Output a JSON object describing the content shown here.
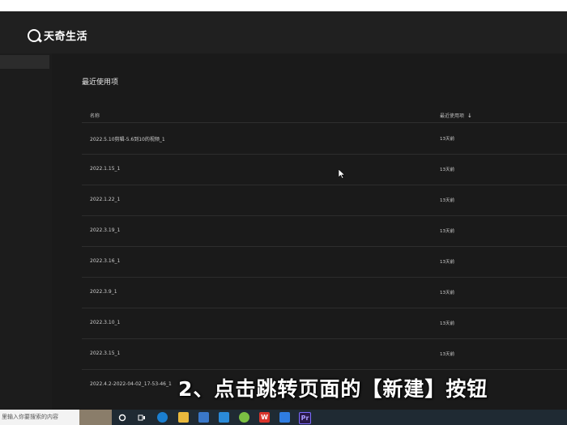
{
  "watermark": {
    "text": "天奇生活"
  },
  "section_title": "最近使用项",
  "table": {
    "col_name": "名称",
    "col_date": "最近使用项",
    "sort_arrow": "↓",
    "rows": [
      {
        "name": "2022.5.10剪辑-5.6到10的视频_1",
        "date": "13天前"
      },
      {
        "name": "2022.1.15_1",
        "date": "13天前"
      },
      {
        "name": "2022.1.22_1",
        "date": "13天前"
      },
      {
        "name": "2022.3.19_1",
        "date": "13天前"
      },
      {
        "name": "2022.3.16_1",
        "date": "13天前"
      },
      {
        "name": "2022.3.9_1",
        "date": "13天前"
      },
      {
        "name": "2022.3.10_1",
        "date": "13天前"
      },
      {
        "name": "2022.3.15_1",
        "date": "13天前"
      },
      {
        "name": "2022.4.2-2022-04-02_17-53-46_1",
        "date": ""
      }
    ]
  },
  "subtitle": "2、点击跳转页面的【新建】按钮",
  "taskbar": {
    "search_placeholder": "里输入你要搜索的内容",
    "icons": [
      "search-icon",
      "task-view-icon",
      "edge-icon",
      "file-explorer-icon",
      "store-icon",
      "mail-icon",
      "app-green-icon",
      "wps-icon",
      "app-blue-icon",
      "premiere-icon"
    ],
    "premiere_label": "Pr",
    "wps_label": "W"
  }
}
